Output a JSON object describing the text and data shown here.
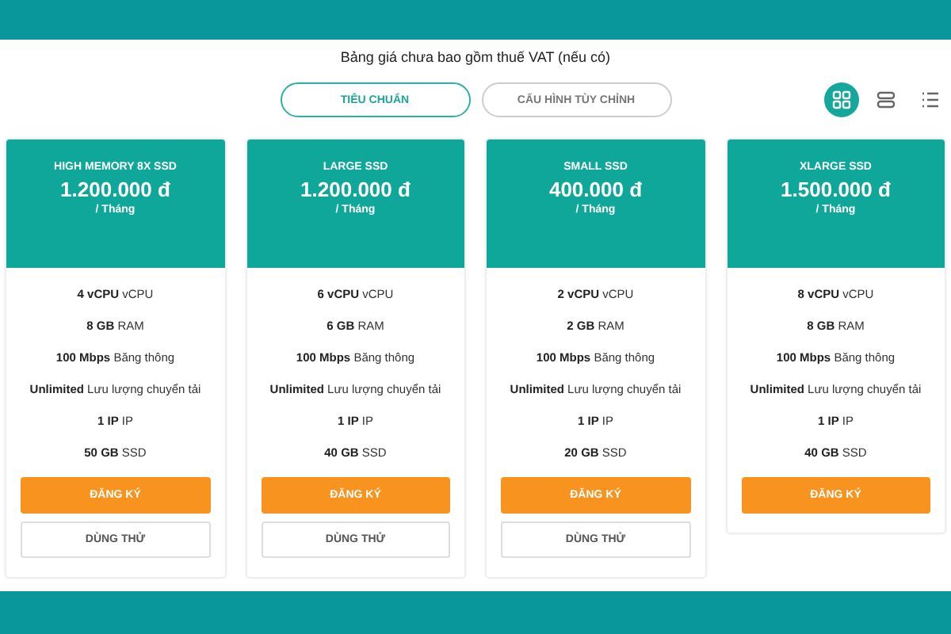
{
  "note": "Bảng giá chưa bao gồm thuế VAT (nếu có)",
  "tabs": [
    {
      "label": "TIÊU CHUẨN",
      "selected": true
    },
    {
      "label": "CẤU HÌNH TÙY CHỈNH",
      "selected": false
    }
  ],
  "view_toggles": [
    {
      "kind": "grid",
      "selected": true
    },
    {
      "kind": "rows",
      "selected": false
    },
    {
      "kind": "list",
      "selected": false
    }
  ],
  "plans": [
    {
      "name": "HIGH MEMORY 8X SSD",
      "price": "1.200.000 đ",
      "period": "/ Tháng",
      "features": [
        "**4 vCPU** vCPU",
        "**8 GB** RAM",
        "**100 Mbps** Băng thông",
        "**Unlimited** Lưu lượng chuyển tải",
        "**1 IP** IP",
        "**50 GB** SSD"
      ],
      "buttons": [
        {
          "kind": "register",
          "label": "ĐĂNG KÝ"
        },
        {
          "kind": "trial",
          "label": "DÙNG THỬ"
        }
      ]
    },
    {
      "name": "LARGE SSD",
      "price": "1.200.000 đ",
      "period": "/ Tháng",
      "features": [
        "**6 vCPU** vCPU",
        "**6 GB** RAM",
        "**100 Mbps** Băng thông",
        "**Unlimited** Lưu lượng chuyển tải",
        "**1 IP** IP",
        "**40 GB** SSD"
      ],
      "buttons": [
        {
          "kind": "register",
          "label": "ĐĂNG KÝ"
        },
        {
          "kind": "trial",
          "label": "DÙNG THỬ"
        }
      ]
    },
    {
      "name": "SMALL SSD",
      "price": "400.000 đ",
      "period": "/ Tháng",
      "features": [
        "**2 vCPU** vCPU",
        "**2 GB** RAM",
        "**100 Mbps** Băng thông",
        "**Unlimited** Lưu lượng chuyển tải",
        "**1 IP** IP",
        "**20 GB** SSD"
      ],
      "buttons": [
        {
          "kind": "register",
          "label": "ĐĂNG KÝ"
        },
        {
          "kind": "trial",
          "label": "DÙNG THỬ"
        }
      ]
    },
    {
      "name": "XLARGE SSD",
      "price": "1.500.000 đ",
      "period": "/ Tháng",
      "features": [
        "**8 vCPU** vCPU",
        "**8 GB** RAM",
        "**100 Mbps** Băng thông",
        "**Unlimited** Lưu lượng chuyển tải",
        "**1 IP** IP",
        "**40 GB** SSD"
      ],
      "buttons": [
        {
          "kind": "register",
          "label": "ĐĂNG KÝ"
        }
      ]
    }
  ]
}
